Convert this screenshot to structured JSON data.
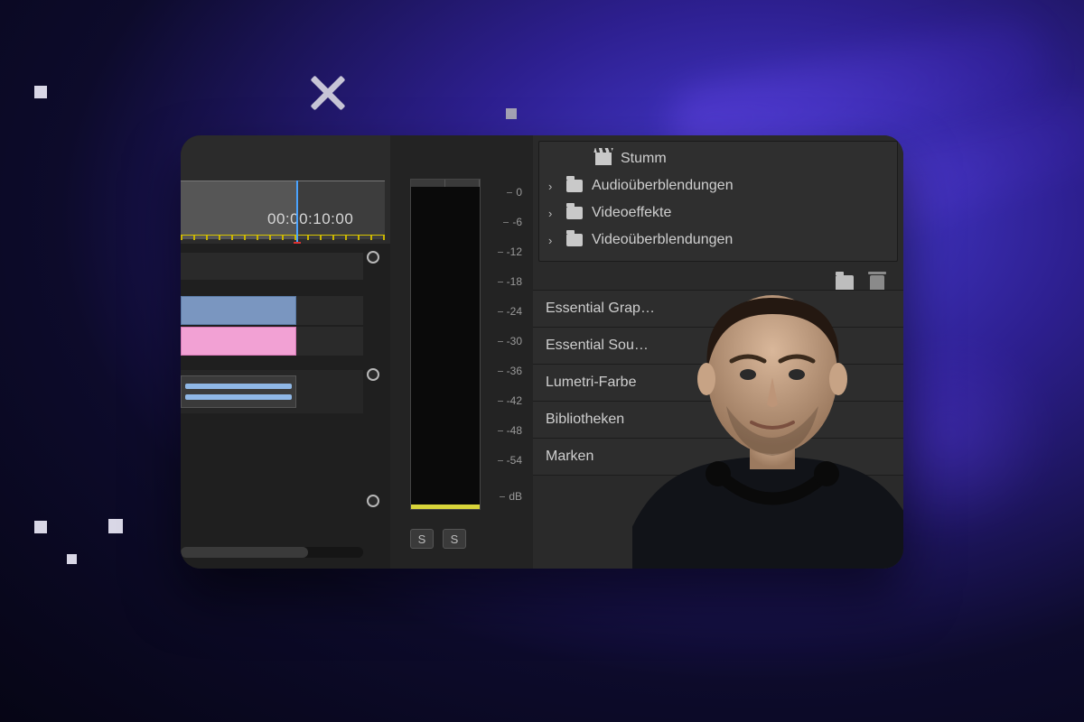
{
  "timeline": {
    "timecode": "00:00:10:00"
  },
  "meter": {
    "scale": [
      "0",
      "-6",
      "-12",
      "-18",
      "-24",
      "-30",
      "-36",
      "-42",
      "-48",
      "-54",
      "dB"
    ],
    "solo_label": "S"
  },
  "effects_tree": {
    "stumm_label": "Stumm",
    "items": [
      "Audioüberblendungen",
      "Videoeffekte",
      "Videoüberblendungen"
    ]
  },
  "panels": [
    "Essential Grap…",
    "Essential Sou…",
    "Lumetri-Farbe",
    "Bibliotheken",
    "Marken"
  ],
  "icons": {
    "chevron": "›",
    "folder": "folder-icon",
    "trash": "trash-icon"
  }
}
